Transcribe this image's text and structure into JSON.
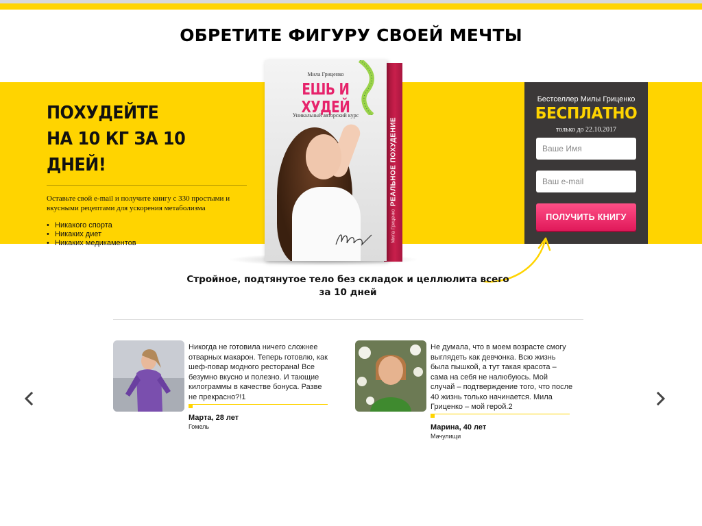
{
  "header": {
    "title": "ОБРЕТИТЕ ФИГУРУ СВОЕЙ МЕЧТЫ"
  },
  "offer": {
    "headline_line1": "ПОХУДЕЙТЕ",
    "headline_line2": "НА 10 КГ ЗА 10 ДНЕЙ!",
    "description": "Оставьте свой e-mail и получите книгу с 330 простыми и вкусными рецептами для ускорения метаболизма",
    "bullets": [
      "Никакого спорта",
      "Никаких диет",
      "Никаких медикаментов"
    ]
  },
  "book": {
    "author": "Мила Гриценко",
    "title": "ЕШЬ И ХУДЕЙ",
    "subtitle": "Уникальный авторский курс",
    "spine_title": "РЕАЛЬНОЕ ПОХУДЕНИЕ",
    "spine_author": "Мила Гриценко"
  },
  "form": {
    "bestseller": "Бестселлер Милы Гриценко",
    "free": "БЕСПЛАТНО",
    "until": "только до 22.10.2017",
    "name_placeholder": "Ваше Имя",
    "email_placeholder": "Ваш e-mail",
    "submit_label": "ПОЛУЧИТЬ КНИГУ"
  },
  "tagline": {
    "line1": "Стройное, подтянутое тело без складок и целлюлита всего",
    "line2": "за 10 дней"
  },
  "testimonials": [
    {
      "text": "Никогда не готовила ничего сложнее отварных макарон. Теперь готовлю, как шеф-повар модного ресторана! Все безумно вкусно и полезно. И тающие килограммы в качестве бонуса. Разве не прекрасно?!1",
      "name": "Марта, 28 лет",
      "city": "Гомель"
    },
    {
      "text": "Не думала, что в моем возрасте смогу выглядеть как девчонка. Всю жизнь была пышкой, а тут такая красота – сама на себя не налюбуюсь. Мой случай – подтверждение того, что после 40 жизнь только начинается. Мила Гриценко – мой герой.2",
      "name": "Марина, 40 лет",
      "city": "Мачулищи"
    }
  ],
  "icons": {
    "nav_prev": "chevron-left-icon",
    "nav_next": "chevron-right-icon",
    "arrow": "curved-arrow-icon"
  },
  "colors": {
    "accent_yellow": "#ffd400",
    "form_dark": "#3b3838",
    "button_pink": "#e0195a",
    "book_title_pink": "#e6236b"
  }
}
